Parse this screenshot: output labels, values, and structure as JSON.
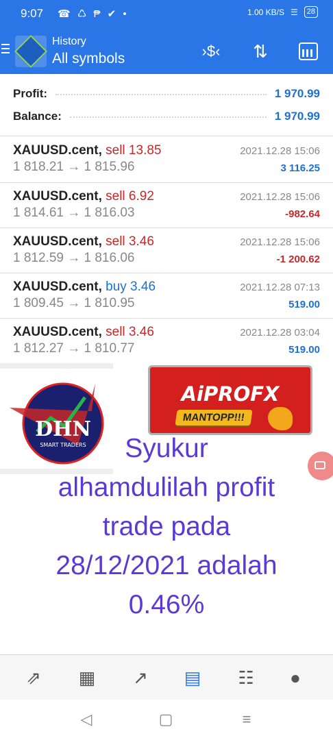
{
  "status_bar": {
    "time": "9:07",
    "notification_icons": "☎ ♺ ₱ ✔ •",
    "net_speed": "1.00 KB/S",
    "battery": "28"
  },
  "app_bar": {
    "title": "History",
    "subtitle": "All symbols",
    "icons": [
      "menu-icon",
      "app-logo",
      "deposit-icon",
      "sort-icon",
      "calendar-icon"
    ]
  },
  "summary": {
    "profit_label": "Profit:",
    "profit_value": "1 970.99",
    "balance_label": "Balance:",
    "balance_value": "1 970.99"
  },
  "trades": [
    {
      "symbol": "XAUUSD.cent,",
      "side": "sell 13.85",
      "side_type": "sell",
      "prices": "1 818.21 → 1 815.96",
      "datetime": "2021.12.28 15:06",
      "pl": "3 116.25",
      "pl_sign": "positive"
    },
    {
      "symbol": "XAUUSD.cent,",
      "side": "sell 6.92",
      "side_type": "sell",
      "prices": "1 814.61 → 1 816.03",
      "datetime": "2021.12.28 15:06",
      "pl": "-982.64",
      "pl_sign": "negative"
    },
    {
      "symbol": "XAUUSD.cent,",
      "side": "sell 3.46",
      "side_type": "sell",
      "prices": "1 812.59 → 1 816.06",
      "datetime": "2021.12.28 15:06",
      "pl": "-1 200.62",
      "pl_sign": "negative"
    },
    {
      "symbol": "XAUUSD.cent,",
      "side": "buy 3.46",
      "side_type": "buy",
      "prices": "1 809.45 → 1 810.95",
      "datetime": "2021.12.28 07:13",
      "pl": "519.00",
      "pl_sign": "positive"
    },
    {
      "symbol": "XAUUSD.cent,",
      "side": "sell 3.46",
      "side_type": "sell",
      "prices": "1 812.27 → 1 810.77",
      "datetime": "2021.12.28 03:04",
      "pl": "519.00",
      "pl_sign": "positive"
    }
  ],
  "overlay": {
    "dhn_logo_text": "DHN",
    "dhn_subtitle": "SMART TRADERS",
    "aiprofx_logo_text": "AiPROFX",
    "aiprofx_sticker": "MANTOPP!!!",
    "caption_lines": [
      "Syukur",
      "alhamdulilah profit",
      "trade pada",
      "28/12/2021 adalah",
      "0.46%"
    ]
  },
  "bottom_nav": {
    "items": [
      "quotes-icon",
      "chart-icon",
      "trade-icon",
      "history-icon",
      "news-icon",
      "chat-icon"
    ],
    "active": "history-icon"
  },
  "colors": {
    "accent": "#2a76e6",
    "sell": "#c62828",
    "buy": "#1f6fd1",
    "caption": "#5a3ad6"
  }
}
